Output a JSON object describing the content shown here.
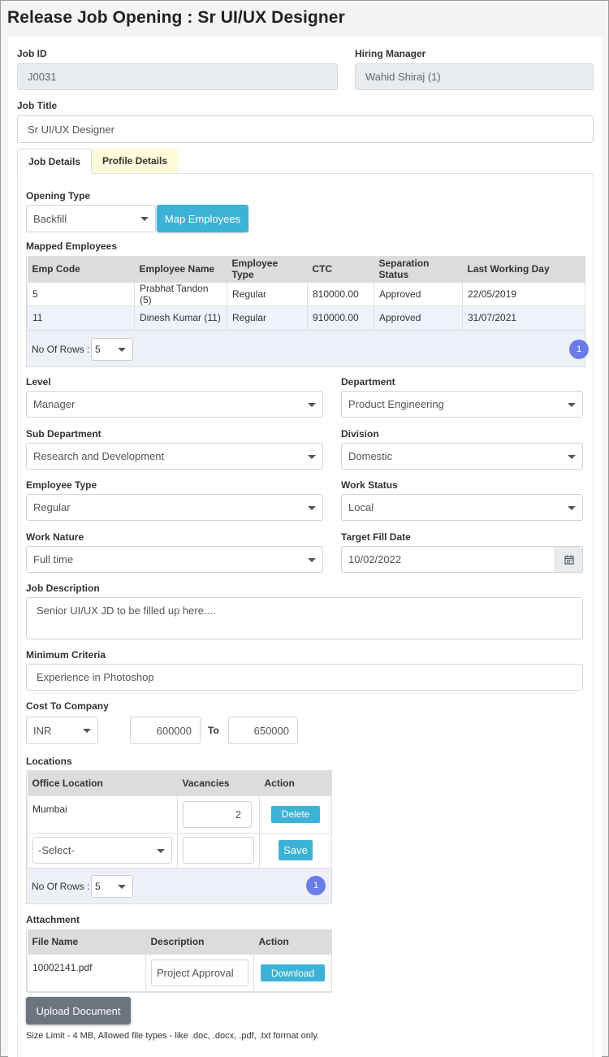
{
  "page": {
    "title": "Release Job Opening : Sr UI/UX Designer"
  },
  "fields": {
    "job_id": {
      "label": "Job ID",
      "value": "J0031"
    },
    "hiring_manager": {
      "label": "Hiring Manager",
      "value": "Wahid Shiraj (1)"
    },
    "job_title": {
      "label": "Job Title",
      "value": "Sr UI/UX Designer"
    }
  },
  "tabs": [
    {
      "label": "Job Details",
      "active": true
    },
    {
      "label": "Profile Details",
      "active": false
    }
  ],
  "opening": {
    "label": "Opening Type",
    "value": "Backfill",
    "map_button": "Map Employees"
  },
  "mapped": {
    "label": "Mapped Employees",
    "headers": [
      "Emp Code",
      "Employee Name",
      "Employee Type",
      "CTC",
      "Separation Status",
      "Last Working Day"
    ],
    "rows": [
      [
        "5",
        "Prabhat Tandon (5)",
        "Regular",
        "810000.00",
        "Approved",
        "22/05/2019"
      ],
      [
        "11",
        "Dinesh Kumar (11)",
        "Regular",
        "910000.00",
        "Approved",
        "31/07/2021"
      ]
    ],
    "rows_label": "No Of Rows :",
    "rows_value": "5",
    "page": "1"
  },
  "form": {
    "level": {
      "label": "Level",
      "value": "Manager"
    },
    "department": {
      "label": "Department",
      "value": "Product Engineering"
    },
    "sub_department": {
      "label": "Sub Department",
      "value": "Research and Development"
    },
    "division": {
      "label": "Division",
      "value": "Domestic"
    },
    "employee_type": {
      "label": "Employee Type",
      "value": "Regular"
    },
    "work_status": {
      "label": "Work Status",
      "value": "Local"
    },
    "work_nature": {
      "label": "Work Nature",
      "value": "Full time"
    },
    "target_fill_date": {
      "label": "Target Fill Date",
      "value": "10/02/2022"
    },
    "job_description": {
      "label": "Job Description",
      "value": "Senior UI/UX JD to be filled up here...."
    },
    "minimum_criteria": {
      "label": "Minimum Criteria",
      "value": "Experience in Photoshop"
    }
  },
  "ctc": {
    "label": "Cost To Company",
    "currency": "INR",
    "from": "600000",
    "to_label": "To",
    "to": "650000"
  },
  "locations": {
    "label": "Locations",
    "headers": [
      "Office Location",
      "Vacancies",
      "Action"
    ],
    "row": {
      "location": "Mumbai",
      "vacancies": "2",
      "action": "Delete"
    },
    "new_row": {
      "select_placeholder": "-Select-",
      "action": "Save"
    },
    "rows_label": "No Of Rows :",
    "rows_value": "5",
    "page": "1"
  },
  "attachment": {
    "label": "Attachment",
    "headers": [
      "File Name",
      "Description",
      "Action"
    ],
    "row": {
      "file": "10002141.pdf",
      "description": "Project Approval",
      "action": "Download"
    },
    "upload_button": "Upload Document",
    "note": "Size Limit - 4 MB, Allowed file types - like .doc, .docx, .pdf, .txt format only."
  },
  "colors": {
    "accent": "#3cb3d6",
    "pager_badge": "#6b7ce8",
    "tab_inactive": "#fdfbd8",
    "upload_button": "#6c757d"
  }
}
